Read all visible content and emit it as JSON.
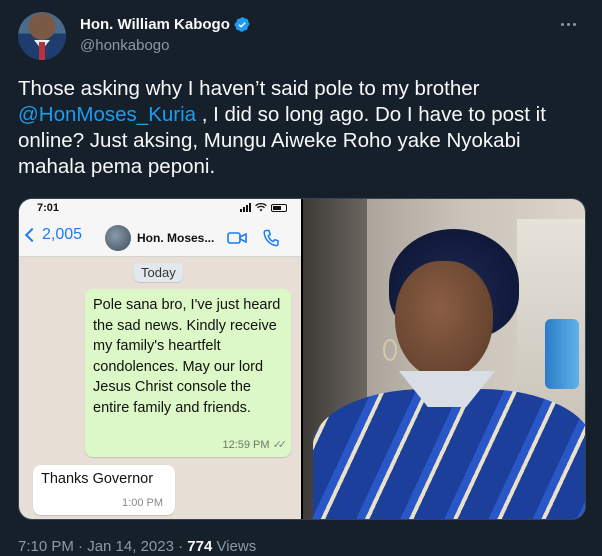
{
  "author": {
    "name": "Hon. William Kabogo",
    "handle": "@honkabogo",
    "verified_icon": "verified-badge-icon",
    "verified_color": "#1d9bf0"
  },
  "tweet": {
    "text_before": "Those asking why I haven’t said pole to my brother ",
    "mention": "@HonMoses_Kuria",
    "text_after": " , I did so long ago. Do I have to post it online? Just aksing, Mungu Aiweke Roho yake Nyokabi mahala pema peponi."
  },
  "whatsapp": {
    "status_time": "7:01",
    "back_count": "2,005",
    "contact_name": "Hon. Moses...",
    "date_chip": "Today",
    "outgoing_message": "Pole sana bro, I've just heard the sad news. Kindly receive my family's heartfelt condolences. May our lord Jesus Christ console the entire family and friends.",
    "outgoing_time": "12:59 PM",
    "incoming_message": "Thanks Governor",
    "incoming_time": "1:00 PM"
  },
  "footer": {
    "timestamp": "7:10 PM · Jan 14, 2023 · ",
    "views_count": "774",
    "views_label": " Views"
  },
  "colors": {
    "background": "#15202b",
    "text": "#f7f9f9",
    "muted": "#8b98a5",
    "link": "#1d9bf0"
  }
}
